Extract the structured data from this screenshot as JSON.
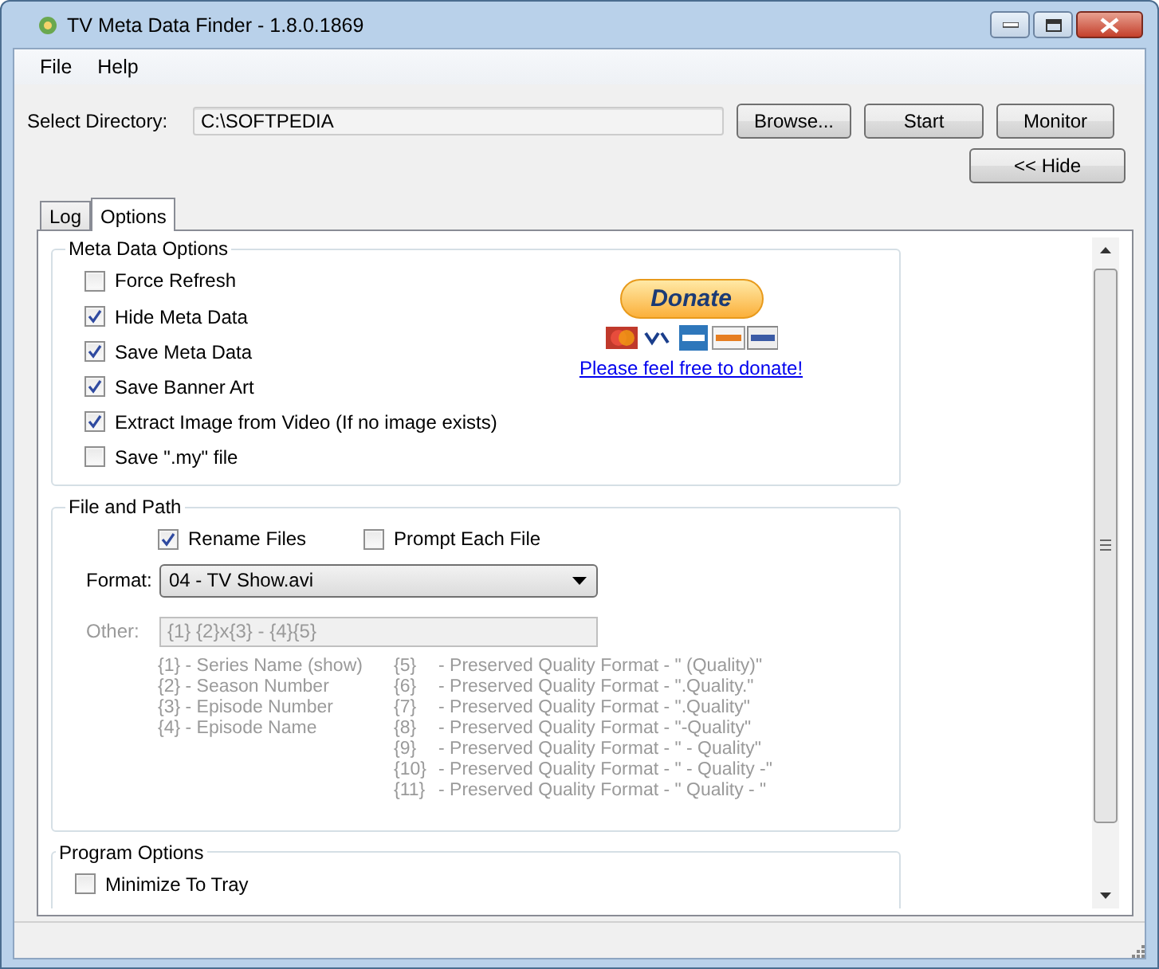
{
  "window": {
    "title": "TV Meta Data Finder - 1.8.0.1869"
  },
  "menu": [
    "File",
    "Help"
  ],
  "directory": {
    "label": "Select Directory:",
    "value": "C:\\SOFTPEDIA"
  },
  "buttons": [
    "Browse...",
    "Start",
    "Monitor"
  ],
  "hide_button": "<< Hide",
  "tabs": [
    {
      "label": "Log",
      "selected": false
    },
    {
      "label": "Options",
      "selected": true
    }
  ],
  "meta_data_options": {
    "title": "Meta Data Options",
    "checkboxes": [
      {
        "label": "Force Refresh",
        "checked": false
      },
      {
        "label": "Hide Meta Data",
        "checked": true
      },
      {
        "label": "Save Meta Data",
        "checked": true
      },
      {
        "label": "Save Banner Art",
        "checked": true
      },
      {
        "label": "Extract Image from Video (If no image exists)",
        "checked": true
      },
      {
        "label": "Save \".my\" file",
        "checked": false
      }
    ],
    "donate": {
      "button": "Donate",
      "link": "Please feel free to donate!"
    }
  },
  "file_and_path": {
    "title": "File and Path",
    "checkboxes": [
      {
        "label": "Rename Files",
        "checked": true
      },
      {
        "label": "Prompt Each File",
        "checked": false
      }
    ],
    "format": {
      "label": "Format:",
      "value": "04 - TV Show.avi"
    },
    "other": {
      "label": "Other:",
      "value": "{1} {2}x{3} - {4}{5}",
      "disabled": true
    },
    "legend_left": [
      "{1} - Series Name (show)",
      "{2} - Season Number",
      "{3} - Episode Number",
      "{4} - Episode Name"
    ],
    "legend_right": [
      {
        "key": "{5}",
        "text": "- Preserved Quality Format - \" (Quality)\""
      },
      {
        "key": "{6}",
        "text": "- Preserved Quality Format - \".Quality.\""
      },
      {
        "key": "{7}",
        "text": "- Preserved Quality Format - \".Quality\""
      },
      {
        "key": "{8}",
        "text": "- Preserved Quality Format - \"-Quality\""
      },
      {
        "key": "{9}",
        "text": "- Preserved Quality Format - \" - Quality\""
      },
      {
        "key": "{10}",
        "text": "- Preserved Quality Format - \" - Quality -\""
      },
      {
        "key": "{11}",
        "text": "- Preserved Quality Format - \" Quality - \""
      }
    ]
  },
  "program_options": {
    "title": "Program Options",
    "checkboxes": [
      {
        "label": "Minimize To Tray",
        "checked": false
      }
    ]
  }
}
